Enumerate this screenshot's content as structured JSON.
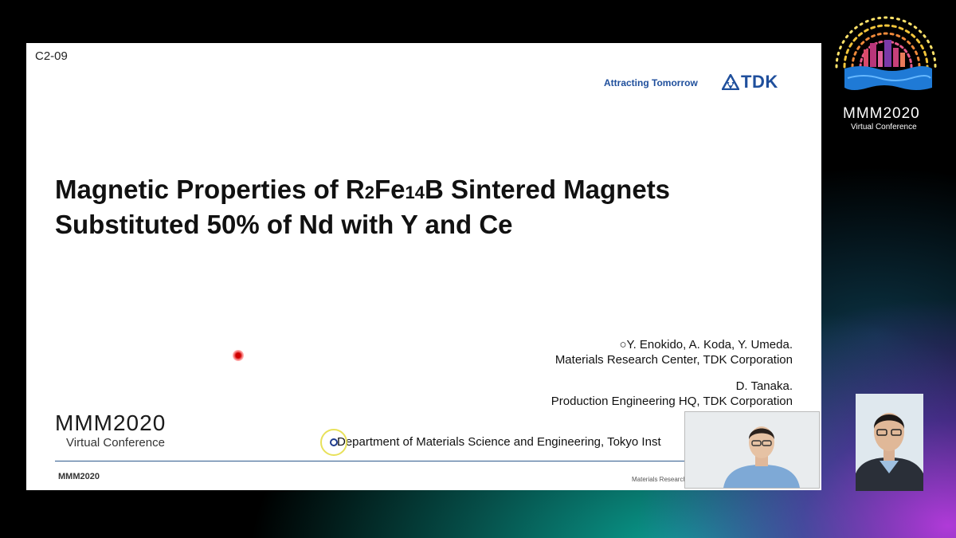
{
  "slide": {
    "code": "C2-09",
    "tagline": "Attracting Tomorrow",
    "brand": "TDK",
    "title_prefix": "Magnetic Properties of R",
    "title_sub1": "2",
    "title_mid": "Fe",
    "title_sub2": "14",
    "title_suffix": "B Sintered Magnets",
    "title_line2": "Substituted 50% of Nd with Y and Ce",
    "authors": [
      "○Y. Enokido, A. Koda, Y. Umeda.",
      "Materials Research Center, TDK Corporation",
      "D. Tanaka.",
      "Production Engineering HQ, TDK Corporation"
    ],
    "department": "Department of Materials Science and Engineering, Tokyo Inst",
    "logo_main": "MMM2020",
    "logo_sub": "Virtual Conference",
    "footer_left": "MMM2020",
    "footer_right": "Materials Research"
  },
  "conference": {
    "name": "MMM2020",
    "subtitle": "Virtual Conference"
  },
  "colors": {
    "brand_blue": "#1f4f9c",
    "laser_red": "#d00000",
    "cursor_ring": "#e8e15a"
  },
  "icons": {
    "tdk_mark": "tdk-logo-icon",
    "laser": "laser-pointer-icon",
    "cursor": "cursor-highlight-icon"
  }
}
